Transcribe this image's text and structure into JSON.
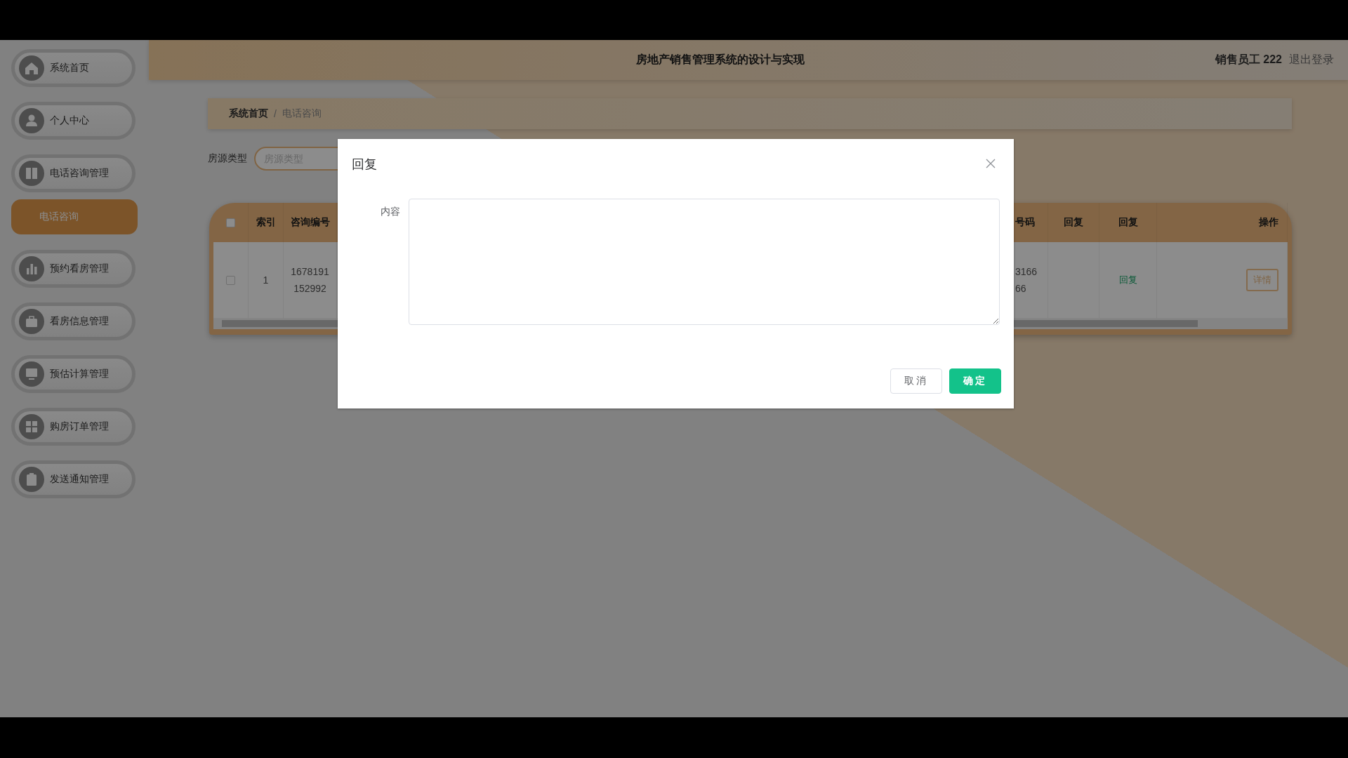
{
  "sidebar": {
    "items": [
      {
        "label": "系统首页",
        "kind": "menu",
        "selected": false
      },
      {
        "label": "个人中心",
        "kind": "menu",
        "selected": false
      },
      {
        "label": "电话咨询管理",
        "kind": "menu",
        "selected": false
      },
      {
        "label": "电话咨询",
        "kind": "submenu",
        "selected": true
      },
      {
        "label": "预约看房管理",
        "kind": "menu",
        "selected": false
      },
      {
        "label": "看房信息管理",
        "kind": "menu",
        "selected": false
      },
      {
        "label": "预估计算管理",
        "kind": "menu",
        "selected": false
      },
      {
        "label": "购房订单管理",
        "kind": "menu",
        "selected": false
      },
      {
        "label": "发送通知管理",
        "kind": "menu",
        "selected": false
      }
    ]
  },
  "header": {
    "title": "房地产销售管理系统的设计与实现",
    "user": "销售员工 222",
    "logout": "退出登录"
  },
  "breadcrumb": {
    "items": [
      "系统首页",
      "电话咨询"
    ],
    "separator": "/"
  },
  "filter": {
    "label": "房源类型",
    "placeholder": "房源类型"
  },
  "table": {
    "select_all_checked": false,
    "columns": [
      "索引",
      "咨询编号",
      "号码",
      "回复",
      "回复",
      "操作"
    ],
    "rows": [
      {
        "checked": false,
        "index": "1",
        "consult_no": "1678191152992",
        "phone_visible": [
          "3166",
          "66"
        ],
        "reply_link": "回复",
        "action": "详情"
      }
    ]
  },
  "modal": {
    "title": "回复",
    "field_label": "内容",
    "buttons": [
      {
        "label": "取消",
        "kind": "default"
      },
      {
        "label": "确定",
        "kind": "primary"
      }
    ]
  }
}
